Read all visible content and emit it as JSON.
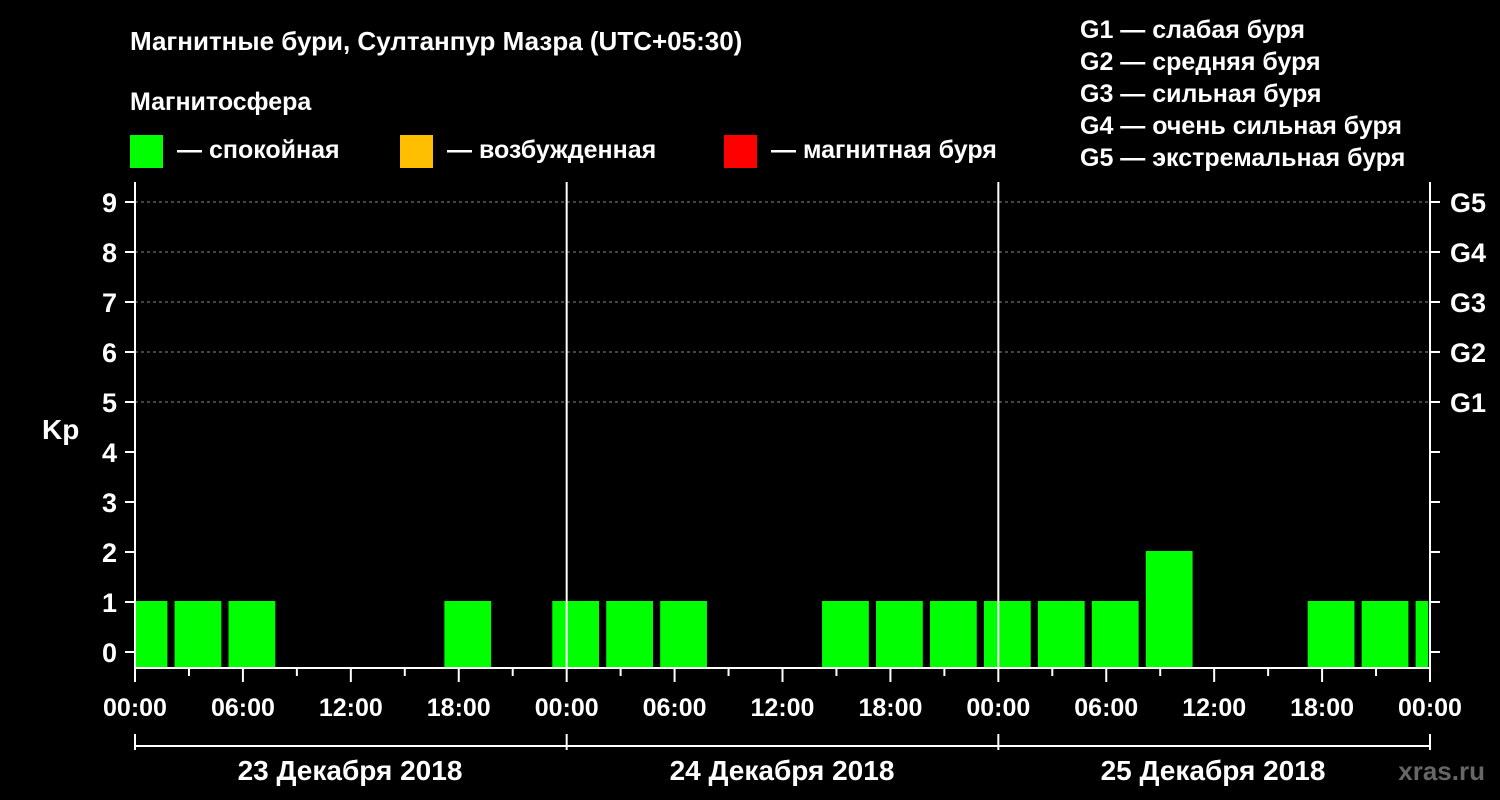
{
  "title": "Магнитные бури, Султанпур Мазра (UTC+05:30)",
  "legend": {
    "heading": "Магнитосфера",
    "items": [
      {
        "label": "— спокойная",
        "color": "#00ff00"
      },
      {
        "label": "— возбужденная",
        "color": "#ffbf00"
      },
      {
        "label": "— магнитная буря",
        "color": "#ff0000"
      }
    ]
  },
  "g_scale": [
    "G1 — слабая буря",
    "G2 — средняя буря",
    "G3 — сильная буря",
    "G4 — очень сильная буря",
    "G5 — экстремальная буря"
  ],
  "site": "xras.ru",
  "chart_data": {
    "type": "bar",
    "ylabel": "Kp",
    "ylim": [
      0,
      9
    ],
    "yticks": [
      0,
      1,
      2,
      3,
      4,
      5,
      6,
      7,
      8,
      9
    ],
    "right_axis": [
      {
        "kp": 5,
        "label": "G1"
      },
      {
        "kp": 6,
        "label": "G2"
      },
      {
        "kp": 7,
        "label": "G3"
      },
      {
        "kp": 8,
        "label": "G4"
      },
      {
        "kp": 9,
        "label": "G5"
      }
    ],
    "xlim_hours": [
      0,
      72
    ],
    "xtick_labels": [
      "00:00",
      "06:00",
      "12:00",
      "18:00",
      "00:00",
      "06:00",
      "12:00",
      "18:00",
      "00:00",
      "06:00",
      "12:00",
      "18:00",
      "00:00"
    ],
    "days": [
      "23 Декабря 2018",
      "24 Декабря 2018",
      "25 Декабря 2018"
    ],
    "bar_color": "#00ff00",
    "bars": [
      {
        "start": 0,
        "end": 1.8,
        "kp": 1
      },
      {
        "start": 2.2,
        "end": 4.8,
        "kp": 1
      },
      {
        "start": 5.2,
        "end": 7.8,
        "kp": 1
      },
      {
        "start": 17.2,
        "end": 19.8,
        "kp": 1
      },
      {
        "start": 23.2,
        "end": 25.8,
        "kp": 1
      },
      {
        "start": 26.2,
        "end": 28.8,
        "kp": 1
      },
      {
        "start": 29.2,
        "end": 31.8,
        "kp": 1
      },
      {
        "start": 38.2,
        "end": 40.8,
        "kp": 1
      },
      {
        "start": 41.2,
        "end": 43.8,
        "kp": 1
      },
      {
        "start": 44.2,
        "end": 46.8,
        "kp": 1
      },
      {
        "start": 47.2,
        "end": 49.8,
        "kp": 1
      },
      {
        "start": 50.2,
        "end": 52.8,
        "kp": 1
      },
      {
        "start": 53.2,
        "end": 55.8,
        "kp": 1
      },
      {
        "start": 56.2,
        "end": 58.8,
        "kp": 2
      },
      {
        "start": 65.2,
        "end": 67.8,
        "kp": 1
      },
      {
        "start": 68.2,
        "end": 70.8,
        "kp": 1
      },
      {
        "start": 71.2,
        "end": 71.9,
        "kp": 1
      }
    ]
  }
}
